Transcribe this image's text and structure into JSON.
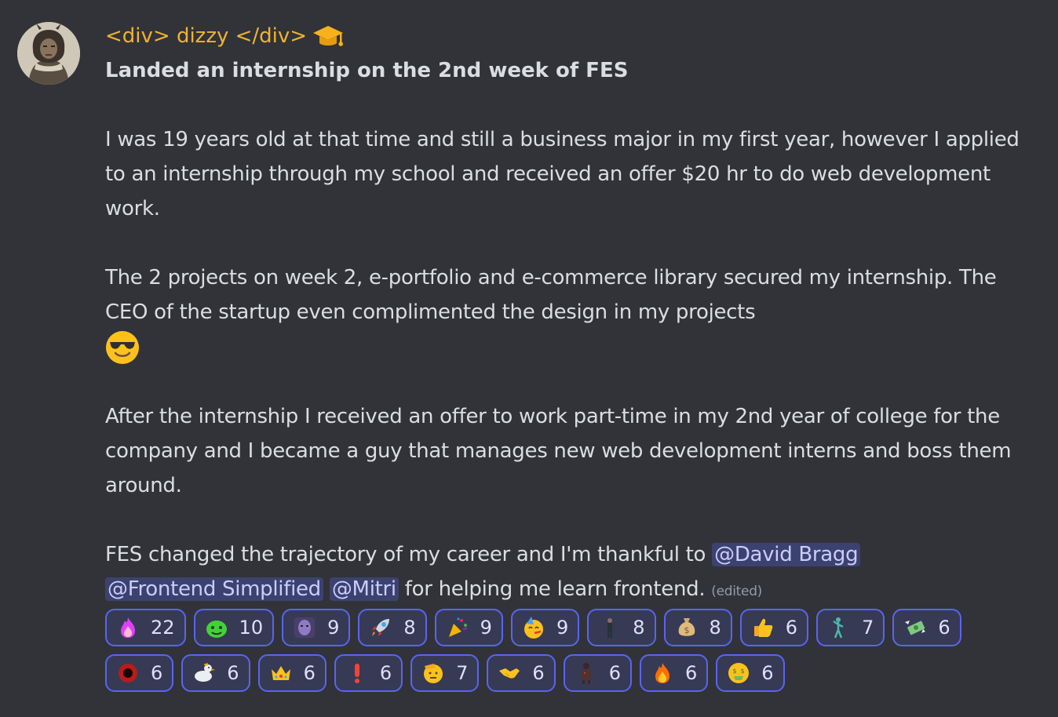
{
  "author": {
    "username": "<div> dizzy </div>",
    "role_icon": "graduation-cap-icon",
    "name_color": "#f0b232"
  },
  "message": {
    "title": "Landed an internship on the 2nd week of FES",
    "p1": "I was 19 years old at that time and still a business major in my first year, however I applied to an internship through my school and received an offer $20 hr to do web development work.",
    "p2": "The 2 projects on week 2, e-portfolio and e-commerce library secured my internship. The CEO of the startup even complimented the design in my projects",
    "p2_emoji": "sunglasses-emoji",
    "p3": "After the internship I received an offer to work part-time in my 2nd year of college for the company and I became a guy that manages new web development interns and boss them around.",
    "p4_before": "FES changed the trajectory of my career and I'm thankful to ",
    "mentions": [
      "@David Bragg",
      "@Frontend Simplified",
      "@Mitri"
    ],
    "p4_after": " for helping me learn frontend.",
    "edited": "(edited)"
  },
  "reactions": {
    "row1": [
      {
        "emoji": "pink-fire-icon",
        "count": "22"
      },
      {
        "emoji": "green-blob-icon",
        "count": "10"
      },
      {
        "emoji": "thanos-icon",
        "count": "9"
      },
      {
        "emoji": "rocket-icon",
        "count": "8"
      },
      {
        "emoji": "party-popper-icon",
        "count": "9"
      },
      {
        "emoji": "party-face-icon",
        "count": "9"
      },
      {
        "emoji": "dancing-man-icon",
        "count": "8"
      },
      {
        "emoji": "money-bag-icon",
        "count": "8"
      },
      {
        "emoji": "thumbs-up-icon",
        "count": "6"
      },
      {
        "emoji": "dancing-figure-icon",
        "count": "7"
      },
      {
        "emoji": "flying-money-icon",
        "count": "6"
      }
    ],
    "row2": [
      {
        "emoji": "red-ring-icon",
        "count": "6"
      },
      {
        "emoji": "duck-icon",
        "count": "6"
      },
      {
        "emoji": "crown-icon",
        "count": "6"
      },
      {
        "emoji": "exclamation-icon",
        "count": "6"
      },
      {
        "emoji": "saluting-face-icon",
        "count": "7"
      },
      {
        "emoji": "handshake-icon",
        "count": "6"
      },
      {
        "emoji": "dark-figure-icon",
        "count": "6"
      },
      {
        "emoji": "fire-icon",
        "count": "6"
      },
      {
        "emoji": "money-mouth-face-icon",
        "count": "6"
      }
    ],
    "accent": "#5865f2"
  }
}
